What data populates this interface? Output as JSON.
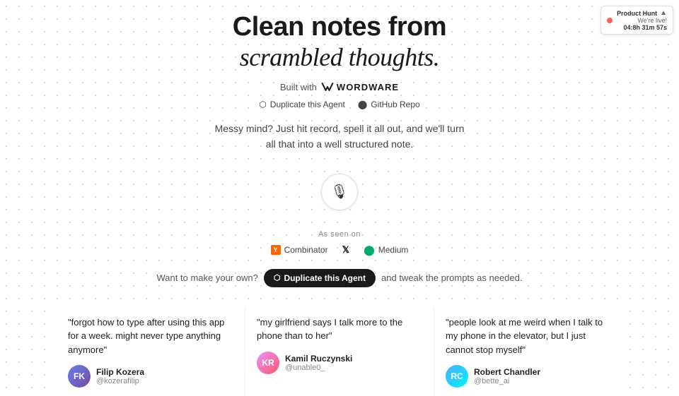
{
  "ph_badge": {
    "label": "Product Hunt",
    "live_text": "We're live!",
    "timer": "04:8h 31m 57s",
    "arrow": "▲"
  },
  "header": {
    "title_line1": "Clean notes from",
    "title_line2": "scrambled thoughts."
  },
  "built_with": {
    "text": "Built with",
    "brand": "WORDWARE"
  },
  "links": {
    "duplicate": "Duplicate this Agent",
    "github": "GitHub Repo"
  },
  "description": {
    "line1": "Messy mind? Just hit record, spell it all out, and we'll turn",
    "line2": "all that into a well structured note."
  },
  "as_seen_on": {
    "label": "As seen on",
    "items": [
      {
        "name": "Y Combinator",
        "short": "YC",
        "display": "Combinator"
      },
      {
        "name": "X",
        "display": "X"
      },
      {
        "name": "Medium",
        "display": "Medium"
      }
    ]
  },
  "duplicate_bar": {
    "prefix": "Want to make your own?",
    "button": "Duplicate this Agent",
    "suffix": "and tweak the prompts as needed."
  },
  "testimonials": [
    {
      "quote": "\"forgot how to type after using this app for a week. might never type anything anymore\"",
      "author_name": "Filip Kozera",
      "author_handle": "@kozerafilip",
      "avatar_initials": "FK"
    },
    {
      "quote": "\"my girlfriend says I talk more to the phone than to her\"",
      "author_name": "Kamil Ruczynski",
      "author_handle": "@unable0_",
      "avatar_initials": "KR"
    },
    {
      "quote": "\"people look at me weird when I talk to my phone in the elevator, but I just cannot stop myself\"",
      "author_name": "Robert Chandler",
      "author_handle": "@bette_ai",
      "avatar_initials": "RC"
    }
  ]
}
